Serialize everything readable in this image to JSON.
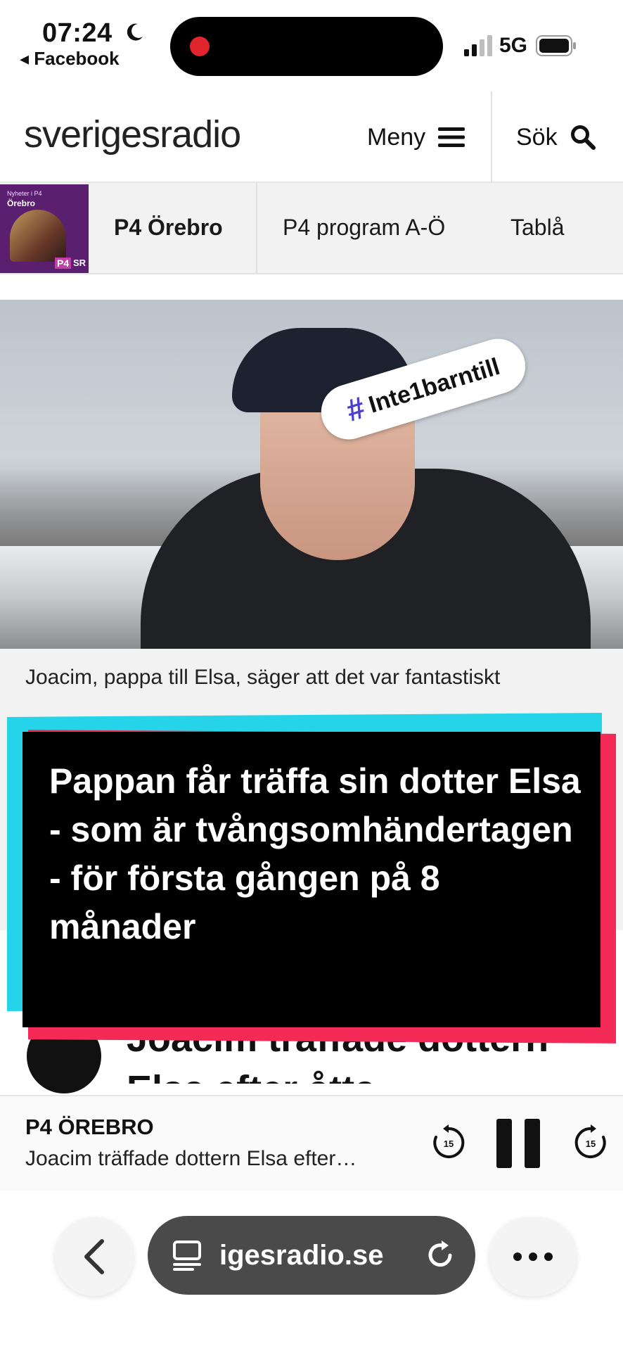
{
  "status_bar": {
    "time": "07:24",
    "back_app": "◂ Facebook",
    "network": "5G"
  },
  "header": {
    "logo": "sverigesradio",
    "menu_label": "Meny",
    "search_label": "Sök"
  },
  "channel_nav": {
    "thumb_small": "Nyheter i P4",
    "thumb_city": "Örebro",
    "thumb_p4": "P4",
    "thumb_sr": "SR",
    "tabs": [
      {
        "label": "P4 Örebro"
      },
      {
        "label": "P4 program A-Ö"
      },
      {
        "label": "Tablå"
      }
    ]
  },
  "hero": {
    "hashtag": "Inte1barntill"
  },
  "caption": "Joacim, pappa till Elsa, säger att det var fantastiskt",
  "headline_overlay": "Pappan får träffa sin dotter Elsa - som är tvångsomhändertagen - för första gången på 8 månader",
  "article_title_partial": "Joacim träffade dottern Elsa efter åtta",
  "player": {
    "station": "P4 ÖREBRO",
    "title": "Joacim träffade dottern Elsa efter…",
    "rewind_label": "15",
    "forward_label": "15"
  },
  "browser": {
    "url": "igesradio.se"
  },
  "colors": {
    "overlay_cyan": "#25d4e8",
    "overlay_red": "#f22a55",
    "hashtag_accent": "#4b3fd1"
  }
}
